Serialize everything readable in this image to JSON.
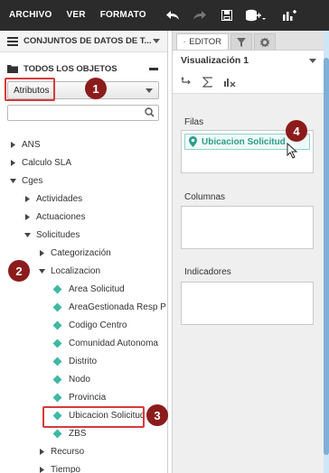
{
  "toolbar": {
    "menu": [
      "ARCHIVO",
      "VER",
      "FORMATO"
    ],
    "icons": [
      "undo-icon",
      "redo-icon",
      "save-icon",
      "add-datasource-icon",
      "chart-add-icon"
    ]
  },
  "left_panel": {
    "datasets_title": "CONJUNTOS DE DATOS DE T...",
    "objects_title": "TODOS LOS OBJETOS",
    "type_select_value": "Atributos",
    "search_placeholder": ""
  },
  "tree": {
    "items": [
      {
        "label": "ANS",
        "depth": 0,
        "kind": "folder",
        "expanded": false
      },
      {
        "label": "Calculo SLA",
        "depth": 0,
        "kind": "folder",
        "expanded": false
      },
      {
        "label": "Cges",
        "depth": 0,
        "kind": "folder",
        "expanded": true
      },
      {
        "label": "Actividades",
        "depth": 1,
        "kind": "folder",
        "expanded": false
      },
      {
        "label": "Actuaciones",
        "depth": 1,
        "kind": "folder",
        "expanded": false
      },
      {
        "label": "Solicitudes",
        "depth": 1,
        "kind": "folder",
        "expanded": true
      },
      {
        "label": "Categorización",
        "depth": 2,
        "kind": "folder",
        "expanded": false
      },
      {
        "label": "Localizacion",
        "depth": 2,
        "kind": "folder",
        "expanded": true
      },
      {
        "label": "Area Solicitud",
        "depth": 3,
        "kind": "attribute"
      },
      {
        "label": "AreaGestionada Resp P",
        "depth": 3,
        "kind": "attribute"
      },
      {
        "label": "Codigo Centro",
        "depth": 3,
        "kind": "attribute"
      },
      {
        "label": "Comunidad Autonoma",
        "depth": 3,
        "kind": "attribute"
      },
      {
        "label": "Distrito",
        "depth": 3,
        "kind": "attribute"
      },
      {
        "label": "Nodo",
        "depth": 3,
        "kind": "attribute"
      },
      {
        "label": "Provincia",
        "depth": 3,
        "kind": "attribute"
      },
      {
        "label": "Ubicacion Solicitud",
        "depth": 3,
        "kind": "attribute"
      },
      {
        "label": "ZBS",
        "depth": 3,
        "kind": "attribute"
      },
      {
        "label": "Recurso",
        "depth": 2,
        "kind": "folder",
        "expanded": false
      },
      {
        "label": "Tiempo",
        "depth": 2,
        "kind": "folder",
        "expanded": false
      }
    ]
  },
  "right_panel": {
    "tabs": [
      {
        "label": "EDITOR",
        "icon": "pencil-icon",
        "active": true
      },
      {
        "label": "",
        "icon": "filter-icon",
        "active": false
      },
      {
        "label": "",
        "icon": "gear-icon",
        "active": false
      }
    ],
    "visualization_title": "Visualización 1",
    "tools": [
      "pivot-icon",
      "sum-icon",
      "chart-clear-icon"
    ],
    "rows_label": "Filas",
    "rows_field": "Ubicacion Solicitud",
    "columns_label": "Columnas",
    "metrics_label": "Indicadores"
  },
  "annotations": {
    "badges": [
      "1",
      "2",
      "3",
      "4"
    ]
  },
  "colors": {
    "toolbar_bg": "#2b2b2b",
    "attribute_diamond": "#3fb8a5",
    "highlight": "#d83a3a",
    "badge": "#8c1c1c"
  }
}
